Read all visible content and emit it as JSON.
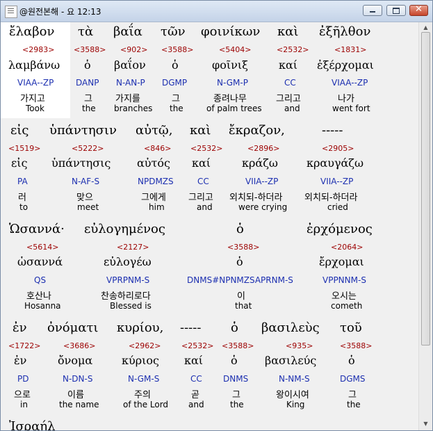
{
  "window": {
    "title": "@원전본해 - 요 12:13",
    "buttons": [
      "minimize",
      "maximize",
      "close"
    ]
  },
  "rows": [
    [
      {
        "greek": "ἔλαβον",
        "ref": "<2983>",
        "lemma": "λαμβάνω",
        "parse": "VIAA--ZP",
        "kor": "가지고",
        "eng": "Took"
      },
      {
        "greek": "τὰ",
        "ref": "<3588>",
        "lemma": "ὁ",
        "parse": "DANP",
        "kor": "그",
        "eng": "the"
      },
      {
        "greek": "βαΐα",
        "ref": "<902>",
        "lemma": "βαΐον",
        "parse": "N-AN-P",
        "kor": "가지를",
        "eng": "branches"
      },
      {
        "greek": "τῶν",
        "ref": "<3588>",
        "lemma": "ὁ",
        "parse": "DGMP",
        "kor": "그",
        "eng": "the"
      },
      {
        "greek": "φοινίκων",
        "ref": "<5404>",
        "lemma": "φοῖνιξ",
        "parse": "N-GM-P",
        "kor": "종려나무",
        "eng": "of palm trees"
      },
      {
        "greek": "καὶ",
        "ref": "<2532>",
        "lemma": "καί",
        "parse": "CC",
        "kor": "그리고",
        "eng": "and"
      },
      {
        "greek": "ἐξῆλθον",
        "ref": "<1831>",
        "lemma": "ἐξέρχομαι",
        "parse": "VIAA--ZP",
        "kor": "나가",
        "eng": "went fort"
      }
    ],
    [
      {
        "greek": "εἰς",
        "ref": "<1519>",
        "lemma": "εἰς",
        "parse": "PA",
        "kor": "러",
        "eng": "to"
      },
      {
        "greek": "ὑπάντησιν",
        "ref": "<5222>",
        "lemma": "ὑπάντησις",
        "parse": "N-AF-S",
        "kor": "맞으",
        "eng": "meet"
      },
      {
        "greek": "αὐτῷ,",
        "ref": "<846>",
        "lemma": "αὐτός",
        "parse": "NPDMZS",
        "kor": "그에게",
        "eng": "him"
      },
      {
        "greek": "καὶ",
        "ref": "<2532>",
        "lemma": "καί",
        "parse": "CC",
        "kor": "그리고",
        "eng": "and"
      },
      {
        "greek": "ἔκραζον,",
        "ref": "<2896>",
        "lemma": "κράζω",
        "parse": "VIIA--ZP",
        "kor": "외치되-하더라",
        "eng": "were crying"
      },
      {
        "greek": "-----",
        "ref": "<2905>",
        "lemma": "κραυγάζω",
        "parse": "VIIA--ZP",
        "kor": "외치되-하더라",
        "eng": "cried"
      }
    ],
    [
      {
        "greek": "Ὡσαννά·",
        "ref": "<5614>",
        "lemma": "ὡσαννά",
        "parse": "QS",
        "kor": "호산나",
        "eng": "Hosanna"
      },
      {
        "greek": "εὐλογημένος",
        "ref": "<2127>",
        "lemma": "εὐλογέω",
        "parse": "VPRPNM-S",
        "kor": "찬송하리로다",
        "eng": "Blessed is"
      },
      {
        "greek": "ὁ",
        "ref": "<3588>",
        "lemma": "ὁ",
        "parse": "DNMS#NPNMZSAPRNM-S",
        "kor": "이",
        "eng": "that"
      },
      {
        "greek": "ἐρχόμενος",
        "ref": "<2064>",
        "lemma": "ἔρχομαι",
        "parse": "VPPNNM-S",
        "kor": "오시는",
        "eng": "cometh"
      }
    ],
    [
      {
        "greek": "ἐν",
        "ref": "<1722>",
        "lemma": "ἐν",
        "parse": "PD",
        "kor": "으로",
        "eng": "in"
      },
      {
        "greek": "ὀνόματι",
        "ref": "<3686>",
        "lemma": "ὄνομα",
        "parse": "N-DN-S",
        "kor": "이름",
        "eng": "the name"
      },
      {
        "greek": "κυρίου,",
        "ref": "<2962>",
        "lemma": "κύριος",
        "parse": "N-GM-S",
        "kor": "주의",
        "eng": "of the Lord"
      },
      {
        "greek": "-----",
        "ref": "<2532>",
        "lemma": "καί",
        "parse": "CC",
        "kor": "곧",
        "eng": "and"
      },
      {
        "greek": "ὁ",
        "ref": "<3588>",
        "lemma": "ὁ",
        "parse": "DNMS",
        "kor": "그",
        "eng": "the"
      },
      {
        "greek": "βασιλεὺς",
        "ref": "<935>",
        "lemma": "βασιλεύς",
        "parse": "N-NM-S",
        "kor": "왕이시여",
        "eng": "King"
      },
      {
        "greek": "τοῦ",
        "ref": "<3588>",
        "lemma": "ὁ",
        "parse": "DGMS",
        "kor": "그",
        "eng": "the"
      }
    ],
    [
      {
        "greek": "Ἰσραήλ"
      }
    ]
  ]
}
